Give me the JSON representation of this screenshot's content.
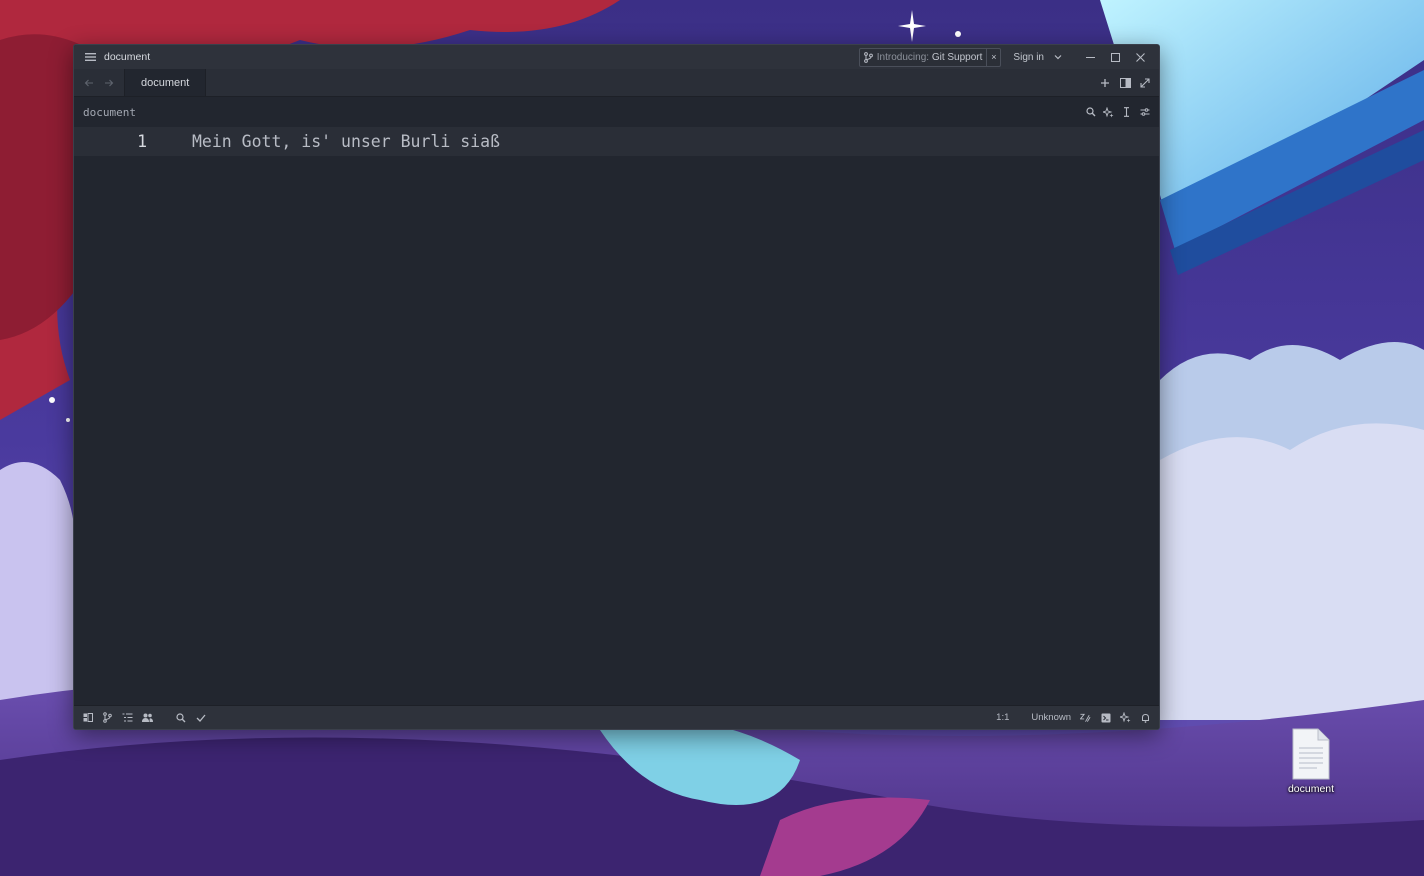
{
  "window": {
    "title": "document",
    "banner_icon": "git-branch-icon",
    "banner_prefix": "Introducing:",
    "banner_label": "Git Support",
    "banner_close": "×",
    "signin_label": "Sign in"
  },
  "tabs": [
    {
      "label": "document",
      "active": true
    }
  ],
  "breadcrumb": "document",
  "editor": {
    "lines": [
      {
        "number": "1",
        "text": "Mein Gott, is' unser Burli siaß"
      }
    ]
  },
  "statusbar": {
    "cursor": "1:1",
    "language": "Unknown"
  },
  "desktop": {
    "file_label": "document"
  },
  "colors": {
    "editor_bg": "#22262f",
    "chrome_bg": "#2e323b",
    "active_line_bg": "#2a2e37",
    "text": "#c9ccd3"
  }
}
